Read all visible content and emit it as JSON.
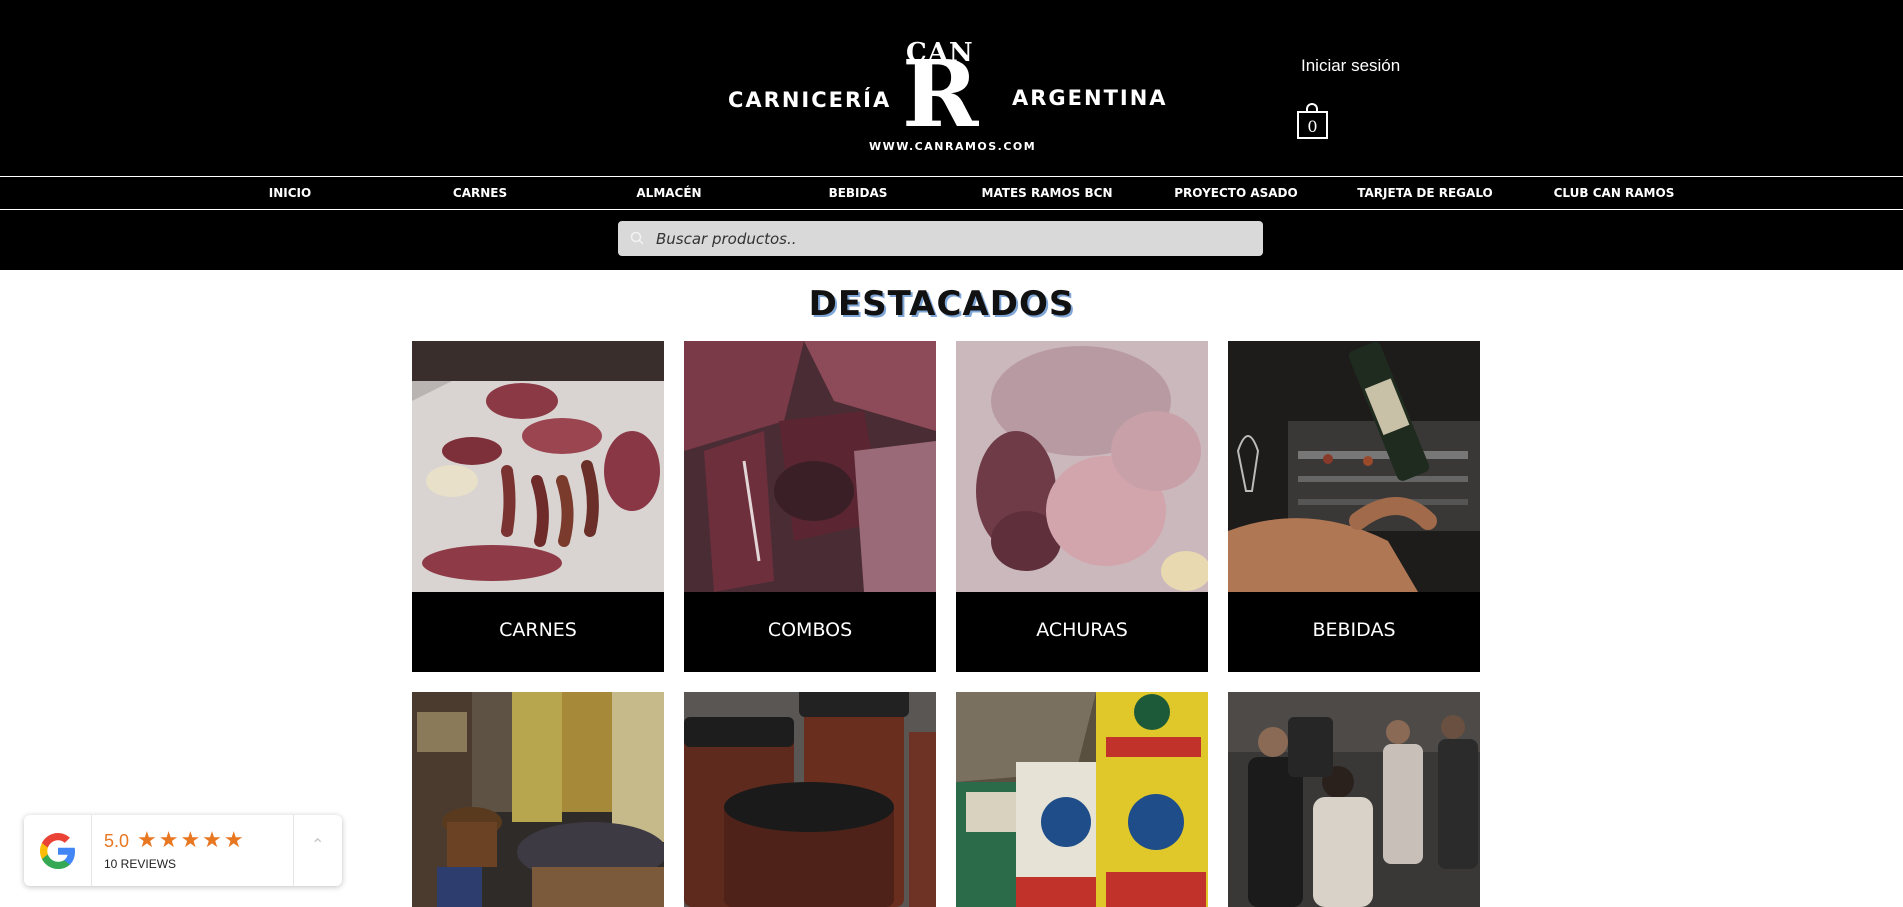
{
  "header": {
    "logo": {
      "left_word": "CARNICERÍA",
      "right_word": "ARGENTINA",
      "top_word": "CAN",
      "letter": "R",
      "url": "WWW.CANRAMOS.COM"
    },
    "login_label": "Iniciar sesión",
    "cart_count": "0"
  },
  "nav": {
    "items": [
      "INICIO",
      "CARNES",
      "ALMACÉN",
      "BEBIDAS",
      "MATES RAMOS BCN",
      "PROYECTO ASADO",
      "TARJETA DE REGALO",
      "CLUB CAN RAMOS"
    ]
  },
  "search": {
    "placeholder": "Buscar productos.."
  },
  "main": {
    "title": "DESTACADOS",
    "cards": [
      "CARNES",
      "COMBOS",
      "ACHURAS",
      "BEBIDAS"
    ]
  },
  "reviews_widget": {
    "rating": "5.0",
    "stars": "★★★★★",
    "reviews": "10 REVIEWS"
  }
}
